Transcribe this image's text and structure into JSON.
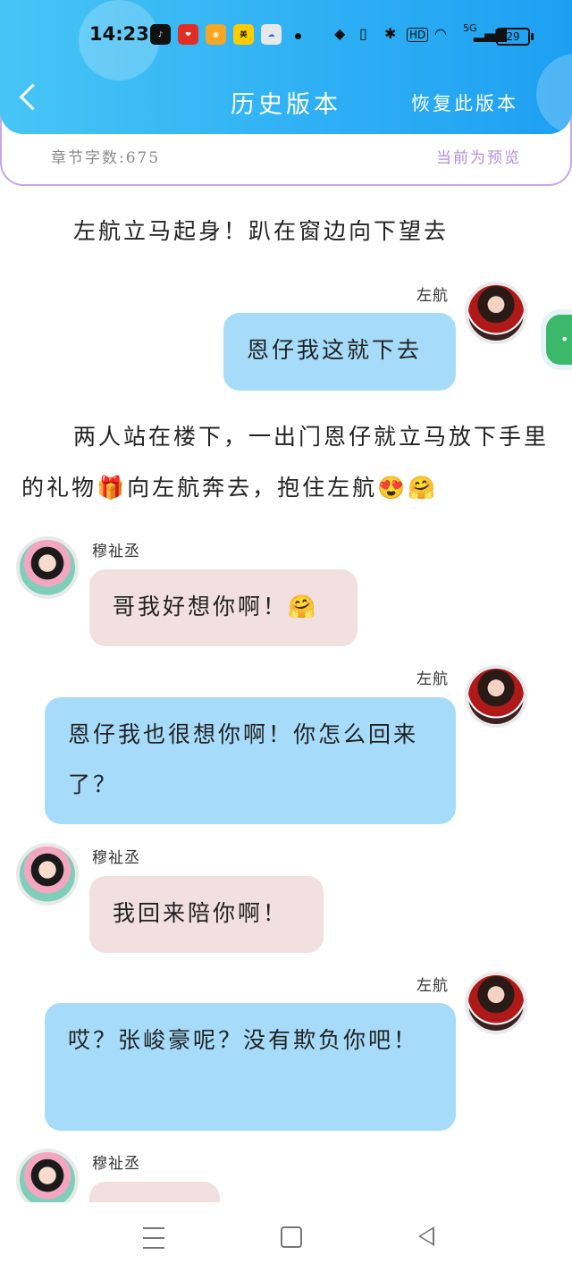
{
  "status": {
    "time": "14:23",
    "app_icons": [
      {
        "name": "tiktok-icon",
        "color": "#111111"
      },
      {
        "name": "pinduoduo-icon",
        "color": "#e02e24"
      },
      {
        "name": "weibo-icon",
        "color": "#f5a623"
      },
      {
        "name": "meituan-icon",
        "color": "#ffcc00"
      },
      {
        "name": "baidu-netdisk-icon",
        "color": "#e8e8e8"
      }
    ],
    "network": "5G",
    "hd": "HD",
    "battery": "29"
  },
  "header": {
    "title": "历史版本",
    "restore_label": "恢复此版本"
  },
  "info": {
    "word_count": "章节字数:675",
    "preview_note": "当前为预览"
  },
  "content": {
    "para1": "左航立马起身！趴在窗边向下望去",
    "name1": "左航",
    "msg1": "恩仔我这就下去",
    "para2": "两人站在楼下，一出门恩仔就立马放下手里的礼物🎁向左航奔去，抱住左航😍🤗",
    "name2": "穆祉丞",
    "msg2": "哥我好想你啊！🤗",
    "name3": "左航",
    "msg3": "恩仔我也很想你啊！你怎么回来了？",
    "name4": "穆祉丞",
    "msg4": "我回来陪你啊！",
    "name5": "左航",
    "msg5": "哎？张峻豪呢？没有欺负你吧！",
    "name6": "穆祉丞"
  },
  "colors": {
    "header_accent": "#2fb0f4",
    "bubble_blue": "#a6dcfa",
    "bubble_pink": "#f2dfe0",
    "preview_purple": "#b48de0",
    "fab_green": "#3bb86a"
  }
}
